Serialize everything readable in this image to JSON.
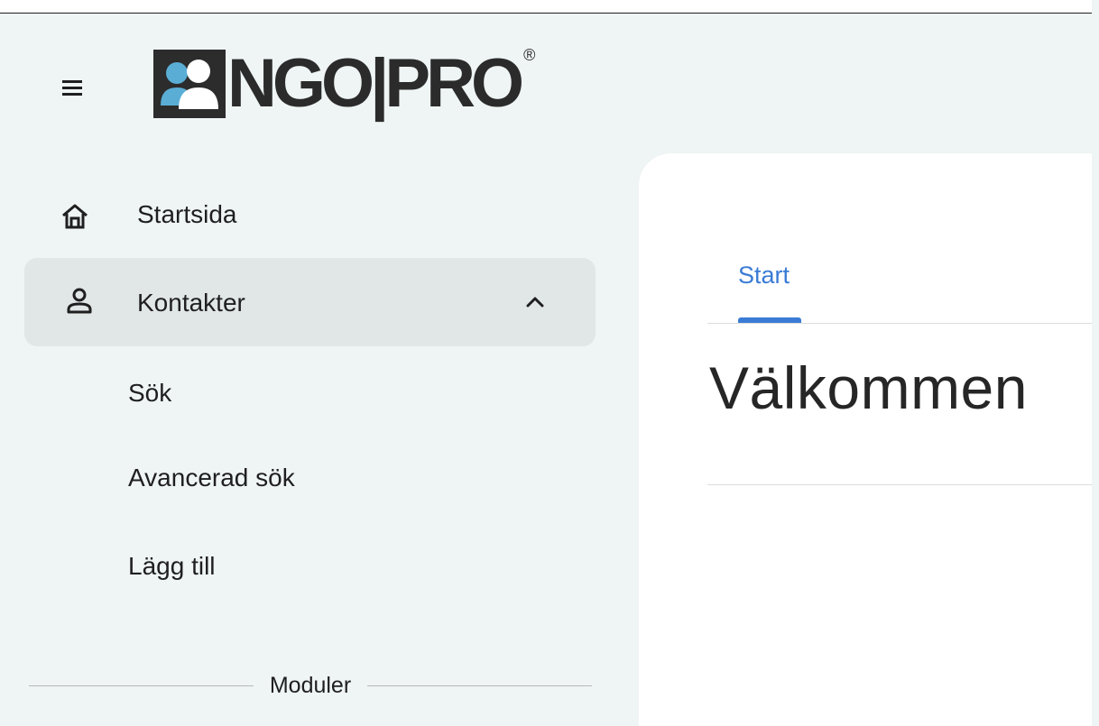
{
  "brand": {
    "name": "NGO|PRO",
    "registered_mark": "®"
  },
  "sidebar": {
    "items": [
      {
        "label": "Startsida",
        "icon": "home-icon"
      },
      {
        "label": "Kontakter",
        "icon": "person-icon",
        "expanded": true,
        "children": [
          {
            "label": "Sök"
          },
          {
            "label": "Avancerad sök"
          },
          {
            "label": "Lägg till"
          }
        ]
      }
    ],
    "section_label": "Moduler"
  },
  "main": {
    "tabs": [
      {
        "label": "Start",
        "active": true
      }
    ],
    "title": "Välkommen"
  },
  "colors": {
    "accent": "#3a7bd5",
    "sidebar_bg": "#eff4f4",
    "active_item_bg": "#e1e6e6",
    "content_bg": "#ffffff"
  }
}
